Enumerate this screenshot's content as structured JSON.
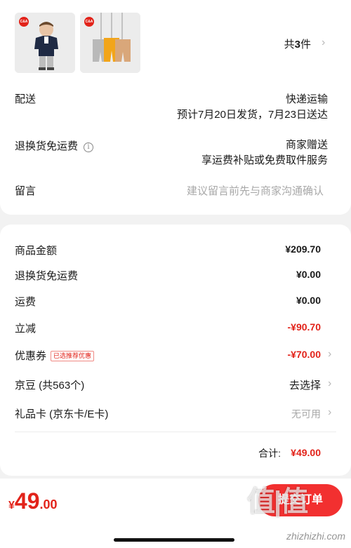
{
  "order": {
    "item_count_prefix": "共",
    "item_count": "3",
    "item_count_suffix": "件"
  },
  "delivery": {
    "label": "配送",
    "method": "快递运输",
    "eta": "预计7月20日发货，7月23日送达"
  },
  "return_shipping": {
    "label": "退换货免运费",
    "value": "商家赠送",
    "detail": "享运费补贴或免费取件服务"
  },
  "message": {
    "label": "留言",
    "placeholder": "建议留言前先与商家沟通确认"
  },
  "price_summary": {
    "rows": [
      {
        "label": "商品金额",
        "value": "¥209.70"
      },
      {
        "label": "退换货免运费",
        "value": "¥0.00"
      },
      {
        "label": "运费",
        "value": "¥0.00"
      },
      {
        "label": "立减",
        "value": "-¥90.70"
      },
      {
        "label": "优惠券",
        "tag": "已选推荐优惠",
        "value": "-¥70.00"
      },
      {
        "label": "京豆 (共563个)",
        "value": "去选择"
      },
      {
        "label": "礼品卡 (京东卡/E卡)",
        "value": "无可用"
      }
    ],
    "total_label": "合计:",
    "total_value": "¥49.00"
  },
  "bottom_bar": {
    "currency": "¥",
    "price_int": "49",
    "price_dec": ".00",
    "submit_label": "提交订单"
  },
  "watermark": {
    "logo": "值|值",
    "url": "zhizhizhi.com"
  },
  "colors": {
    "accent": "#e2231a",
    "button": "#f23030",
    "background": "#f2f2f2"
  }
}
